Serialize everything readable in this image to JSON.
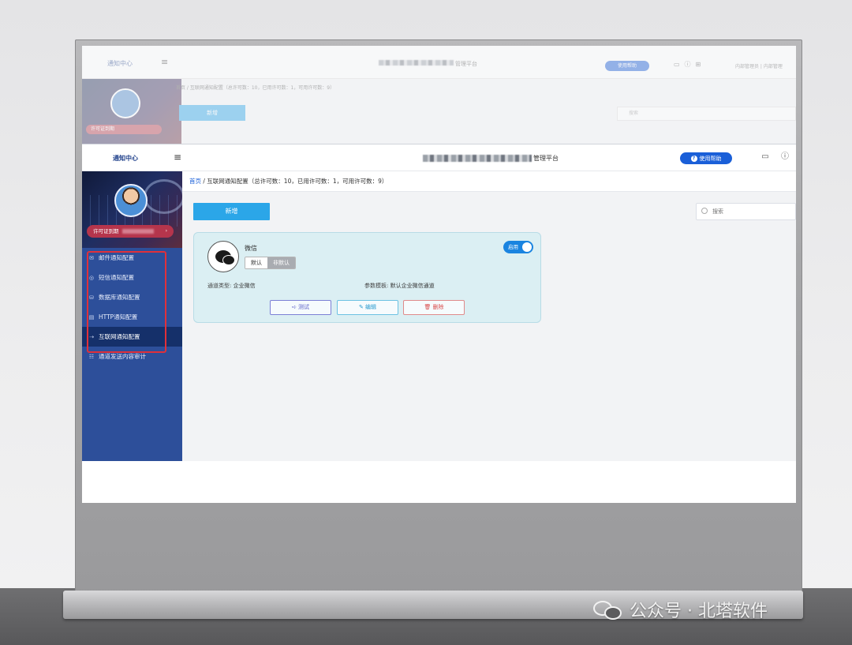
{
  "ghost": {
    "title": "通知中心",
    "platform_suffix": "管理平台",
    "help_label": "使用帮助",
    "user_text": "内部管理员 | 内部管理",
    "breadcrumb": "首页 / 互联网通知配置（总许可数：10，已用许可数：1，可用许可数：9）",
    "license_label": "许可证到期",
    "add_label": "新增",
    "search_placeholder": "搜索"
  },
  "header": {
    "title": "通知中心",
    "platform_suffix": "管理平台",
    "help_label": "使用帮助"
  },
  "sidebar": {
    "license_label": "许可证到期",
    "items": [
      {
        "label": "邮件通知配置",
        "icon": "mail-icon",
        "glyph": "✉"
      },
      {
        "label": "短信通知配置",
        "icon": "sms-icon",
        "glyph": "◎"
      },
      {
        "label": "数据库通知配置",
        "icon": "database-icon",
        "glyph": "⛁"
      },
      {
        "label": "HTTP通知配置",
        "icon": "http-icon",
        "glyph": "▤"
      },
      {
        "label": "互联网通知配置",
        "icon": "internet-icon",
        "glyph": "⇢",
        "active": true
      },
      {
        "label": "通道发送内容审计",
        "icon": "audit-icon",
        "glyph": "☷"
      }
    ]
  },
  "breadcrumb": {
    "home": "首页",
    "separator": " / ",
    "current": "互联网通知配置（总许可数：10，已用许可数：1，可用许可数：9）"
  },
  "toolbar": {
    "add_label": "新增",
    "search_placeholder": "搜索"
  },
  "card": {
    "name": "微信",
    "seg_default": "默认",
    "seg_nondefault": "非默认",
    "toggle_label": "启用",
    "channel_type_label": "通道类型:",
    "channel_type_value": "企业微信",
    "template_label": "参数模板:",
    "template_value": "默认企业微信通道",
    "test_label": "测试",
    "edit_label": "编辑",
    "delete_label": "删除"
  },
  "watermark": {
    "text": "公众号 · 北塔软件"
  },
  "colors": {
    "sidebar": "#2d4f9a",
    "sidebar_active": "#15306a",
    "accent": "#2ba6e8",
    "help_button": "#1a5fd8",
    "card_bg": "#dbeff3",
    "highlight_box": "#e0303a"
  }
}
